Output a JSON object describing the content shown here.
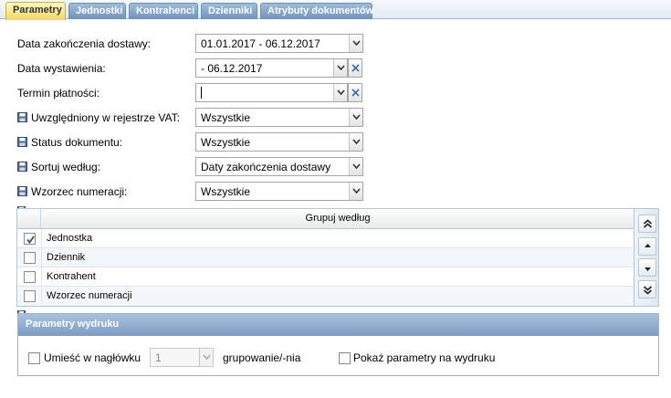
{
  "tabs": [
    {
      "label": "Parametry",
      "active": true
    },
    {
      "label": "Jednostki",
      "active": false
    },
    {
      "label": "Kontrahenci",
      "active": false
    },
    {
      "label": "Dzienniki",
      "active": false
    },
    {
      "label": "Atrybuty dokumentów",
      "active": false
    }
  ],
  "form": {
    "delivery_date_label": "Data zakończenia dostawy:",
    "delivery_date_value": "01.01.2017 - 06.12.2017",
    "issue_date_label": "Data wystawienia:",
    "issue_date_value": "- 06.12.2017",
    "payment_term_label": "Termin płatności:",
    "payment_term_value": "",
    "vat_register_label": "Uwzględniony w rejestrze VAT:",
    "vat_register_value": "Wszystkie",
    "doc_status_label": "Status dokumentu:",
    "doc_status_value": "Wszystkie",
    "sort_by_label": "Sortuj według:",
    "sort_by_value": "Daty zakończenia dostawy",
    "numbering_label": "Wzorzec numeracji:",
    "numbering_value": "Wszystkie"
  },
  "group_grid": {
    "header": "Grupuj według",
    "rows": [
      {
        "label": "Jednostka",
        "checked": true
      },
      {
        "label": "Dziennik",
        "checked": false
      },
      {
        "label": "Kontrahent",
        "checked": false
      },
      {
        "label": "Wzorzec numeracji",
        "checked": false
      }
    ]
  },
  "print_params": {
    "title": "Parametry wydruku",
    "header_checkbox_label": "Umieść w nagłówku",
    "grouping_count": "1",
    "grouping_suffix": "grupowanie/-nia",
    "show_params_label": "Pokaż parametry na wydruku"
  },
  "icons": {
    "save": "floppy-disk-icon",
    "dropdown": "chevron-down-icon",
    "clear": "close-icon",
    "move_top": "double-arrow-up-icon",
    "move_up": "arrow-up-icon",
    "move_down": "arrow-down-icon",
    "move_bottom": "double-arrow-down-icon"
  },
  "colors": {
    "active_tab": "#f3d860",
    "inactive_tab": "#7d9cc2",
    "fieldset_header": "#8aa8cc"
  }
}
